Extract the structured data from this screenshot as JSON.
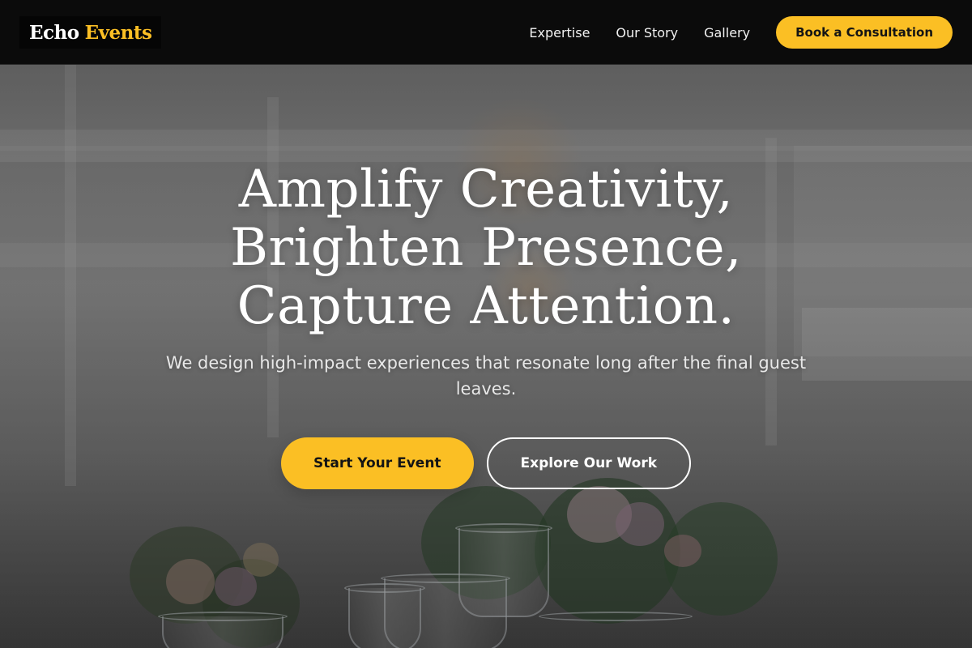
{
  "brand": {
    "name_part1": "Echo",
    "name_part2": "Events",
    "accent_color": "#fbbf24"
  },
  "nav": {
    "links": [
      "Expertise",
      "Our Story",
      "Gallery"
    ],
    "cta_label": "Book a Consultation"
  },
  "hero": {
    "headline_lines": [
      "Amplify Creativity,",
      "Brighten Presence,",
      "Capture Attention."
    ],
    "subtitle": "We design high-impact experiences that resonate long after the final guest leaves.",
    "primary_cta": "Start Your Event",
    "secondary_cta": "Explore Our Work"
  },
  "colors": {
    "header_bg": "#0b0b0b",
    "button_yellow": "#fbbf24",
    "text_dark": "#141414",
    "text_light": "#ffffff"
  }
}
